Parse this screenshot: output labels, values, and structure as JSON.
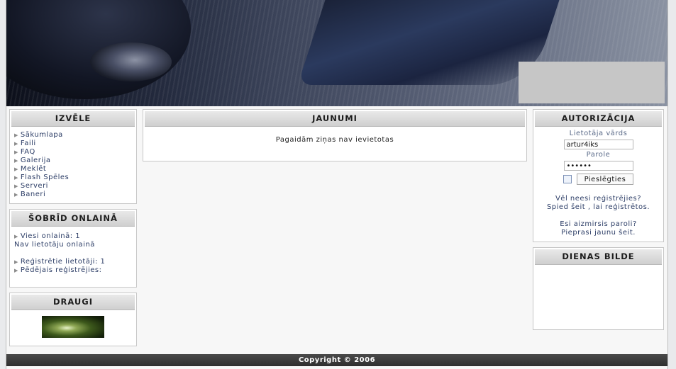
{
  "left": {
    "menu": {
      "title": "IZVĒLE",
      "items": [
        "Sākumlapa",
        "Faili",
        "FAQ",
        "Galerija",
        "Meklēt",
        "Flash Spēles",
        "Serveri",
        "Baneri"
      ]
    },
    "online": {
      "title": "ŠOBRĪD ONLAINĀ",
      "guests": "Viesi onlainā: 1",
      "no_users": "Nav lietotāju onlainā",
      "registered": "Reģistrētie lietotāji: 1",
      "last_registered": "Pēdējais reģistrējies:"
    },
    "friends": {
      "title": "DRAUGI"
    }
  },
  "center": {
    "news": {
      "title": "JAUNUMI",
      "message": "Pagaidām ziņas nav ievietotas"
    }
  },
  "right": {
    "auth": {
      "title": "AUTORIZĀCIJA",
      "username_label": "Lietotāja vārds",
      "username_value": "artur4iks",
      "password_label": "Parole",
      "password_value": "••••••",
      "login_button": "Pieslēgties",
      "register_q": "Vēl neesi reģistrējies?",
      "register_link": "Spied šeit , lai reģistrētos.",
      "forgot_q": "Esi aizmirsis paroli?",
      "forgot_link": "Pieprasi jaunu šeit."
    },
    "daily_image": {
      "title": "DIENAS BILDE"
    }
  },
  "footer": {
    "copyright": "Copyright © 2006"
  }
}
